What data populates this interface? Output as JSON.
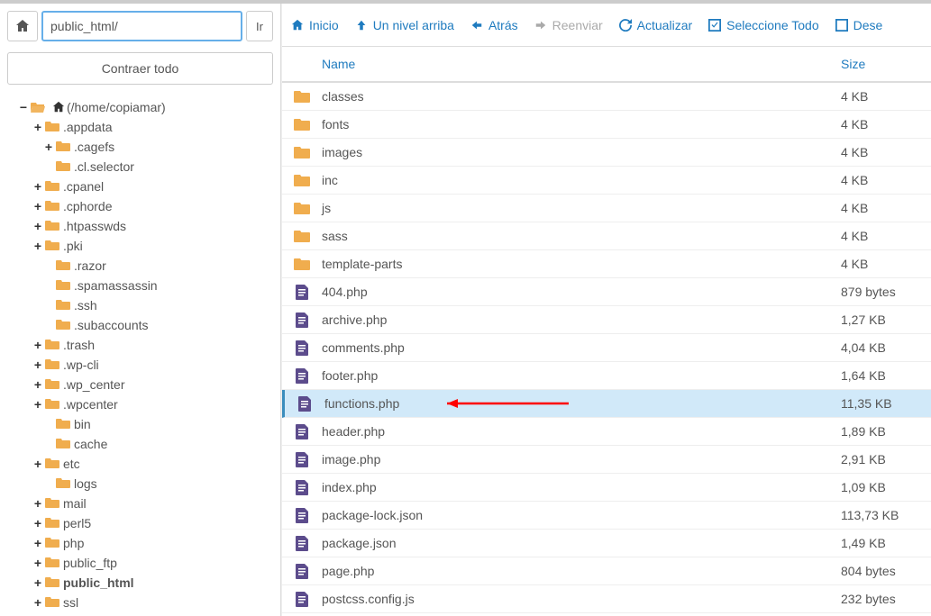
{
  "path": {
    "value": "public_html/",
    "go_label": "Ir"
  },
  "collapse_label": "Contraer todo",
  "tree": {
    "root_label": "(/home/copiamar)",
    "nodes": [
      {
        "label": ".appdata",
        "level": 1,
        "exp": "plus"
      },
      {
        "label": ".cagefs",
        "level": 2,
        "exp": "plus"
      },
      {
        "label": ".cl.selector",
        "level": 2,
        "exp": "none"
      },
      {
        "label": ".cpanel",
        "level": 1,
        "exp": "plus"
      },
      {
        "label": ".cphorde",
        "level": 1,
        "exp": "plus"
      },
      {
        "label": ".htpasswds",
        "level": 1,
        "exp": "plus"
      },
      {
        "label": ".pki",
        "level": 1,
        "exp": "plus"
      },
      {
        "label": ".razor",
        "level": 2,
        "exp": "none"
      },
      {
        "label": ".spamassassin",
        "level": 2,
        "exp": "none"
      },
      {
        "label": ".ssh",
        "level": 2,
        "exp": "none"
      },
      {
        "label": ".subaccounts",
        "level": 2,
        "exp": "none"
      },
      {
        "label": ".trash",
        "level": 1,
        "exp": "plus"
      },
      {
        "label": ".wp-cli",
        "level": 1,
        "exp": "plus"
      },
      {
        "label": ".wp_center",
        "level": 1,
        "exp": "plus"
      },
      {
        "label": ".wpcenter",
        "level": 1,
        "exp": "plus"
      },
      {
        "label": "bin",
        "level": 2,
        "exp": "none"
      },
      {
        "label": "cache",
        "level": 2,
        "exp": "none"
      },
      {
        "label": "etc",
        "level": 1,
        "exp": "plus"
      },
      {
        "label": "logs",
        "level": 2,
        "exp": "none"
      },
      {
        "label": "mail",
        "level": 1,
        "exp": "plus"
      },
      {
        "label": "perl5",
        "level": 1,
        "exp": "plus"
      },
      {
        "label": "php",
        "level": 1,
        "exp": "plus"
      },
      {
        "label": "public_ftp",
        "level": 1,
        "exp": "plus"
      },
      {
        "label": "public_html",
        "level": 1,
        "exp": "plus",
        "bold": true
      },
      {
        "label": "ssl",
        "level": 1,
        "exp": "plus"
      }
    ]
  },
  "toolbar": {
    "inicio": "Inicio",
    "up": "Un nivel arriba",
    "back": "Atrás",
    "forward": "Reenviar",
    "refresh": "Actualizar",
    "select_all": "Seleccione Todo",
    "deselect": "Dese"
  },
  "columns": {
    "name": "Name",
    "size": "Size"
  },
  "files": [
    {
      "name": "classes",
      "size": "4 KB",
      "type": "folder"
    },
    {
      "name": "fonts",
      "size": "4 KB",
      "type": "folder"
    },
    {
      "name": "images",
      "size": "4 KB",
      "type": "folder"
    },
    {
      "name": "inc",
      "size": "4 KB",
      "type": "folder"
    },
    {
      "name": "js",
      "size": "4 KB",
      "type": "folder"
    },
    {
      "name": "sass",
      "size": "4 KB",
      "type": "folder"
    },
    {
      "name": "template-parts",
      "size": "4 KB",
      "type": "folder"
    },
    {
      "name": "404.php",
      "size": "879 bytes",
      "type": "file"
    },
    {
      "name": "archive.php",
      "size": "1,27 KB",
      "type": "file"
    },
    {
      "name": "comments.php",
      "size": "4,04 KB",
      "type": "file"
    },
    {
      "name": "footer.php",
      "size": "1,64 KB",
      "type": "file"
    },
    {
      "name": "functions.php",
      "size": "11,35 KB",
      "type": "file",
      "selected": true,
      "arrow": true
    },
    {
      "name": "header.php",
      "size": "1,89 KB",
      "type": "file"
    },
    {
      "name": "image.php",
      "size": "2,91 KB",
      "type": "file"
    },
    {
      "name": "index.php",
      "size": "1,09 KB",
      "type": "file"
    },
    {
      "name": "package-lock.json",
      "size": "113,73 KB",
      "type": "file"
    },
    {
      "name": "package.json",
      "size": "1,49 KB",
      "type": "file"
    },
    {
      "name": "page.php",
      "size": "804 bytes",
      "type": "file"
    },
    {
      "name": "postcss.config.js",
      "size": "232 bytes",
      "type": "file"
    }
  ]
}
